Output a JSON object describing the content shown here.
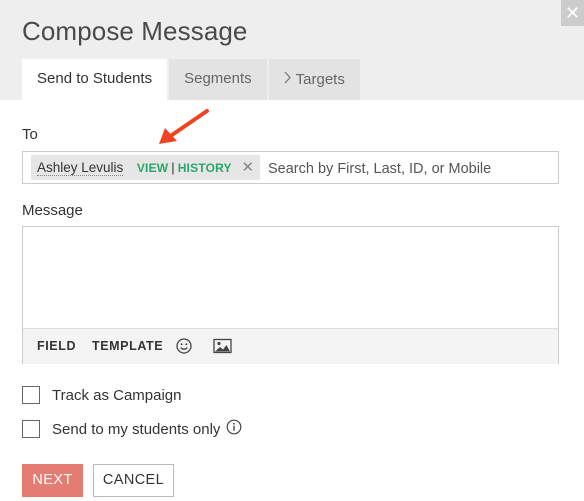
{
  "dialog": {
    "title": "Compose Message",
    "close_icon": "close-icon"
  },
  "tabs": [
    {
      "label": "Send to Students",
      "active": true
    },
    {
      "label": "Segments",
      "active": false
    },
    {
      "label": "Targets",
      "active": false,
      "icon": "chevron-right-icon"
    }
  ],
  "to": {
    "label": "To",
    "recipient": {
      "name": "Ashley Levulis",
      "view_link": "VIEW",
      "separator": "|",
      "history_link": "HISTORY",
      "remove_icon": "close-icon"
    },
    "placeholder": "Search by First, Last, ID, or Mobile",
    "value": ""
  },
  "message": {
    "label": "Message",
    "value": "",
    "toolbar": {
      "field_label": "FIELD",
      "template_label": "TEMPLATE",
      "emoji_icon": "emoji-icon",
      "image_icon": "image-icon"
    }
  },
  "options": {
    "track_campaign": {
      "label": "Track as Campaign",
      "checked": false
    },
    "my_students_only": {
      "label": "Send to my students only",
      "checked": false,
      "info_icon": "info-icon"
    }
  },
  "actions": {
    "next_label": "NEXT",
    "cancel_label": "CANCEL"
  },
  "colors": {
    "header_bg": "#eeeeee",
    "link_green": "#2aa56c",
    "next_button": "#e57c71",
    "annotation_arrow": "#ee4422"
  }
}
